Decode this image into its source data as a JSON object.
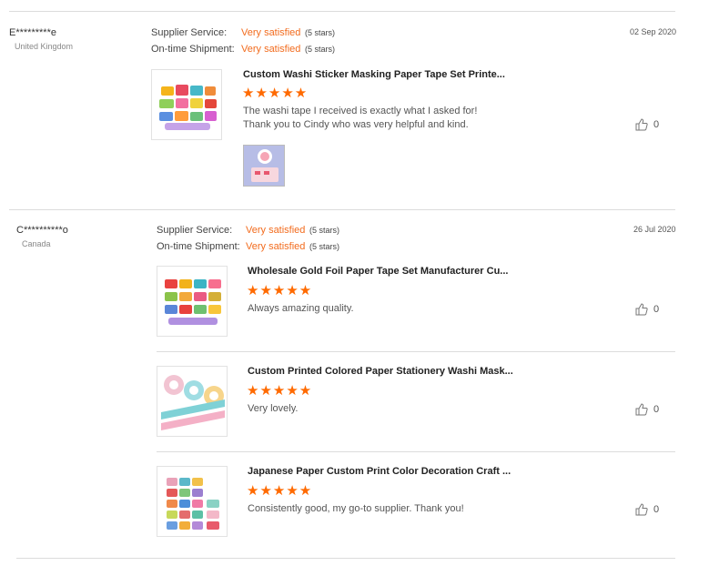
{
  "reviews": [
    {
      "user": "E*********e",
      "country": "United Kingdom",
      "date": "02 Sep 2020",
      "supplier_label": "Supplier Service:",
      "supplier_value": "Very satisfied",
      "supplier_stars": "(5 stars)",
      "shipment_label": "On-time Shipment:",
      "shipment_value": "Very satisfied",
      "shipment_stars": "(5 stars)",
      "items": [
        {
          "title": "Custom Washi Sticker Masking Paper Tape Set Printe...",
          "stars": "★★★★★",
          "rating": 5,
          "comment_line1": "The washi tape I received is exactly what I asked for!",
          "comment_line2": "Thank you to Cindy who was very helpful and kind.",
          "likes": "0"
        }
      ]
    },
    {
      "user": "C**********o",
      "country": "Canada",
      "date": "26 Jul 2020",
      "supplier_label": "Supplier Service:",
      "supplier_value": "Very satisfied",
      "supplier_stars": "(5 stars)",
      "shipment_label": "On-time Shipment:",
      "shipment_value": "Very satisfied",
      "shipment_stars": "(5 stars)",
      "items": [
        {
          "title": "Wholesale Gold Foil Paper Tape Set Manufacturer Cu...",
          "stars": "★★★★★",
          "rating": 5,
          "comment": "Always amazing quality.",
          "likes": "0"
        },
        {
          "title": "Custom Printed Colored Paper Stationery Washi Mask...",
          "stars": "★★★★★",
          "rating": 5,
          "comment": "Very lovely.",
          "likes": "0"
        },
        {
          "title": "Japanese Paper Custom Print Color Decoration Craft ...",
          "stars": "★★★★★",
          "rating": 5,
          "comment": "Consistently good, my go-to supplier. Thank you!",
          "likes": "0"
        }
      ]
    }
  ],
  "colors": {
    "accent": "#f26b1d",
    "stars": "#ff6a00",
    "divider": "#dcdcdc"
  },
  "icons": {
    "like": "thumbs-up-icon"
  }
}
